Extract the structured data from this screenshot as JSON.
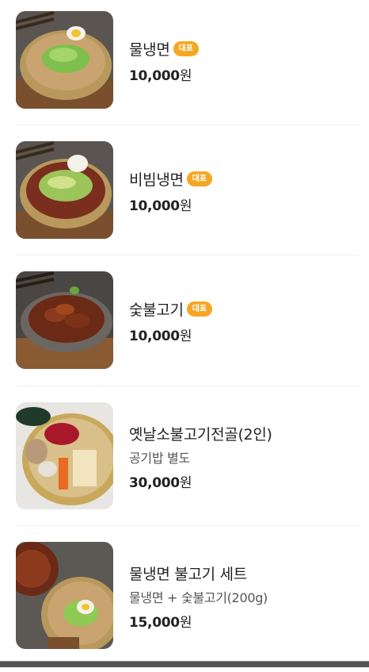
{
  "menu": {
    "items": [
      {
        "name": "물냉면",
        "badge": "대표",
        "description": "",
        "price": "10,000",
        "unit": "원",
        "image": "mul-naengmyeon-photo"
      },
      {
        "name": "비빔냉면",
        "badge": "대표",
        "description": "",
        "price": "10,000",
        "unit": "원",
        "image": "bibim-naengmyeon-photo"
      },
      {
        "name": "숯불고기",
        "badge": "대표",
        "description": "",
        "price": "10,000",
        "unit": "원",
        "image": "bulgogi-photo"
      },
      {
        "name": "옛날소불고기전골(2인)",
        "badge": "",
        "description": "공기밥 별도",
        "price": "30,000",
        "unit": "원",
        "image": "jeongol-photo"
      },
      {
        "name": "물냉면 불고기 세트",
        "badge": "",
        "description": "물냉면 + 숯불고기(200g)",
        "price": "15,000",
        "unit": "원",
        "image": "set-photo"
      }
    ]
  },
  "colors": {
    "badge": "#f6a623",
    "divider": "#efefef",
    "text": "#222222",
    "subtext": "#555555"
  }
}
